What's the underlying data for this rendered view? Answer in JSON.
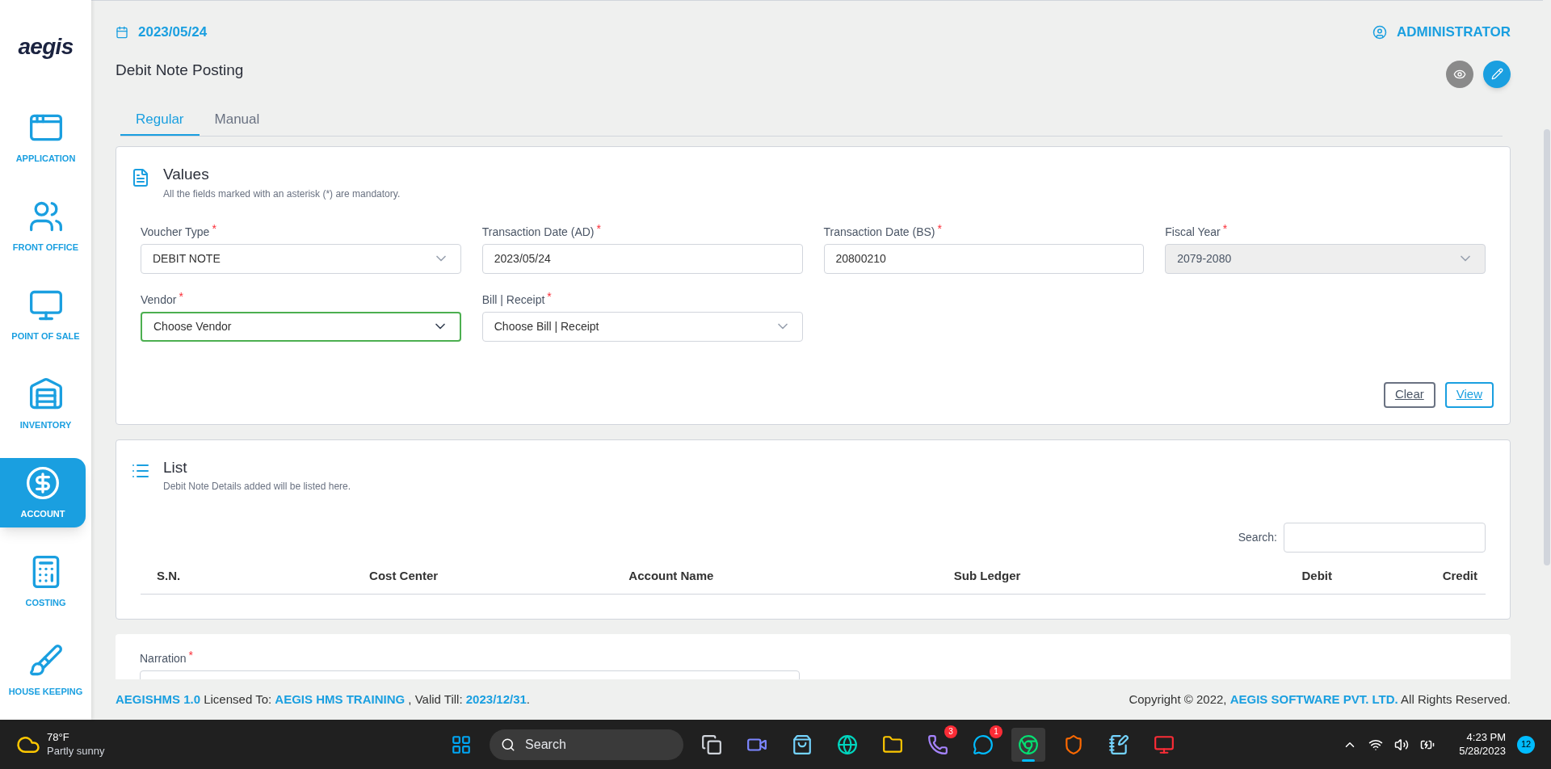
{
  "logo": "aegis",
  "sidebar": {
    "items": [
      {
        "label": "APPLICATION",
        "kind": "application",
        "selected": false
      },
      {
        "label": "FRONT OFFICE",
        "kind": "front-office",
        "selected": false
      },
      {
        "label": "POINT OF SALE",
        "kind": "pos",
        "selected": false
      },
      {
        "label": "INVENTORY",
        "kind": "inventory",
        "selected": false
      },
      {
        "label": "ACCOUNT",
        "kind": "account",
        "selected": true
      },
      {
        "label": "COSTING",
        "kind": "costing",
        "selected": false
      },
      {
        "label": "HOUSE KEEPING",
        "kind": "housekeeping",
        "selected": false
      }
    ]
  },
  "header": {
    "date": "2023/05/24",
    "user": "ADMINISTRATOR"
  },
  "page_title": "Debit Note Posting",
  "tabs": [
    {
      "label": "Regular",
      "selected": true
    },
    {
      "label": "Manual",
      "selected": false
    }
  ],
  "values_card": {
    "title": "Values",
    "subtitle": "All the fields marked with an asterisk (*) are mandatory.",
    "fields": [
      {
        "label": "Voucher Type",
        "required_mark": "*",
        "kind": "select",
        "value": "DEBIT NOTE",
        "disabled": false,
        "focused": false
      },
      {
        "label": "Transaction Date (AD)",
        "required_mark": "*",
        "kind": "text",
        "value": "2023/05/24",
        "disabled": false,
        "focused": false
      },
      {
        "label": "Transaction Date (BS)",
        "required_mark": "*",
        "kind": "text",
        "value": "20800210",
        "disabled": false,
        "focused": false
      },
      {
        "label": "Fiscal Year",
        "required_mark": "*",
        "kind": "select",
        "value": "2079-2080",
        "disabled": true,
        "focused": false
      },
      {
        "label": "Vendor",
        "required_mark": "*",
        "kind": "select",
        "placeholder": "Choose Vendor",
        "disabled": false,
        "focused": true
      },
      {
        "label": "Bill | Receipt",
        "required_mark": "*",
        "kind": "select",
        "placeholder": "Choose Bill | Receipt",
        "disabled": false,
        "focused": false
      }
    ],
    "buttons": [
      {
        "label": "Clear",
        "kind": "secondary"
      },
      {
        "label": "View",
        "kind": "primary"
      }
    ]
  },
  "list_card": {
    "title": "List",
    "subtitle": "Debit Note Details added will be listed here.",
    "search_label": "Search:",
    "columns": [
      "S.N.",
      "Cost Center",
      "Account Name",
      "Sub Ledger",
      "Debit",
      "Credit"
    ]
  },
  "narration": {
    "label": "Narration",
    "required_mark": "*"
  },
  "footer": {
    "license": "**AEGISHMS 1.0** Licensed To: **AEGIS HMS TRAINING** , Valid Till: **2023/12/31**.",
    "copyright": "Copyright © 2022, **AEGIS SOFTWARE PVT. LTD.** All Rights Reserved."
  },
  "taskbar": {
    "weather": {
      "temp": "78°F",
      "condition": "Partly sunny"
    },
    "search_placeholder": "Search",
    "apps": [
      {
        "kind": "windows",
        "active": false
      },
      {
        "kind": "task-view",
        "active": false
      },
      {
        "kind": "meet",
        "active": false
      },
      {
        "kind": "store",
        "active": false
      },
      {
        "kind": "edge",
        "active": false
      },
      {
        "kind": "folder",
        "active": false
      },
      {
        "kind": "viber",
        "badge": "3",
        "active": false
      },
      {
        "kind": "skype",
        "badge": "1",
        "active": false
      },
      {
        "kind": "chrome",
        "active": true
      },
      {
        "kind": "brave",
        "active": false
      },
      {
        "kind": "notepad",
        "active": false
      },
      {
        "kind": "anydesk",
        "active": false
      }
    ],
    "time": "4:23 PM",
    "date": "5/28/2023",
    "notifications": "12"
  }
}
